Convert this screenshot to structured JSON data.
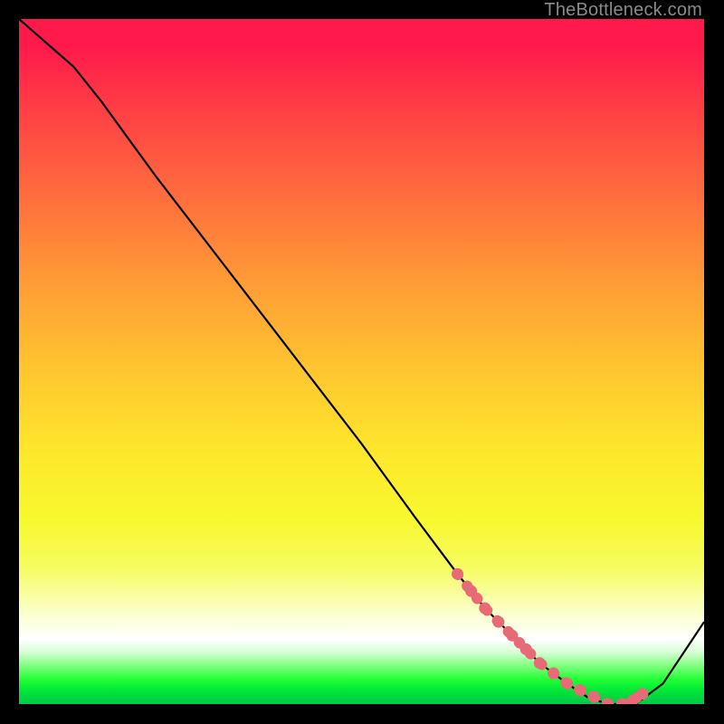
{
  "watermark": "TheBottleneck.com",
  "marker_color": "#e96a77",
  "line_color": "#000000",
  "chart_data": {
    "type": "line",
    "title": "",
    "xlabel": "",
    "ylabel": "",
    "xlim": [
      0,
      100
    ],
    "ylim": [
      0,
      100
    ],
    "series": [
      {
        "name": "curve",
        "x": [
          0,
          8,
          12,
          20,
          30,
          40,
          50,
          58,
          64,
          68,
          72,
          76,
          80,
          83,
          86,
          88,
          90,
          94,
          98,
          100
        ],
        "y": [
          100,
          93,
          88,
          77,
          64,
          51,
          38,
          27,
          19,
          14,
          10,
          6,
          3,
          1,
          0,
          0,
          0,
          3,
          9,
          12
        ]
      }
    ],
    "markers": {
      "name": "highlight",
      "comment": "dotted pink segment on the valley",
      "x": [
        64,
        66,
        68,
        70,
        72,
        74,
        76,
        78,
        80,
        82,
        84,
        86,
        88,
        89.5,
        91
      ],
      "y": [
        19,
        16.5,
        14,
        12,
        10,
        8,
        6,
        4.5,
        3,
        2,
        1,
        0,
        0,
        0.5,
        1.5
      ]
    }
  }
}
